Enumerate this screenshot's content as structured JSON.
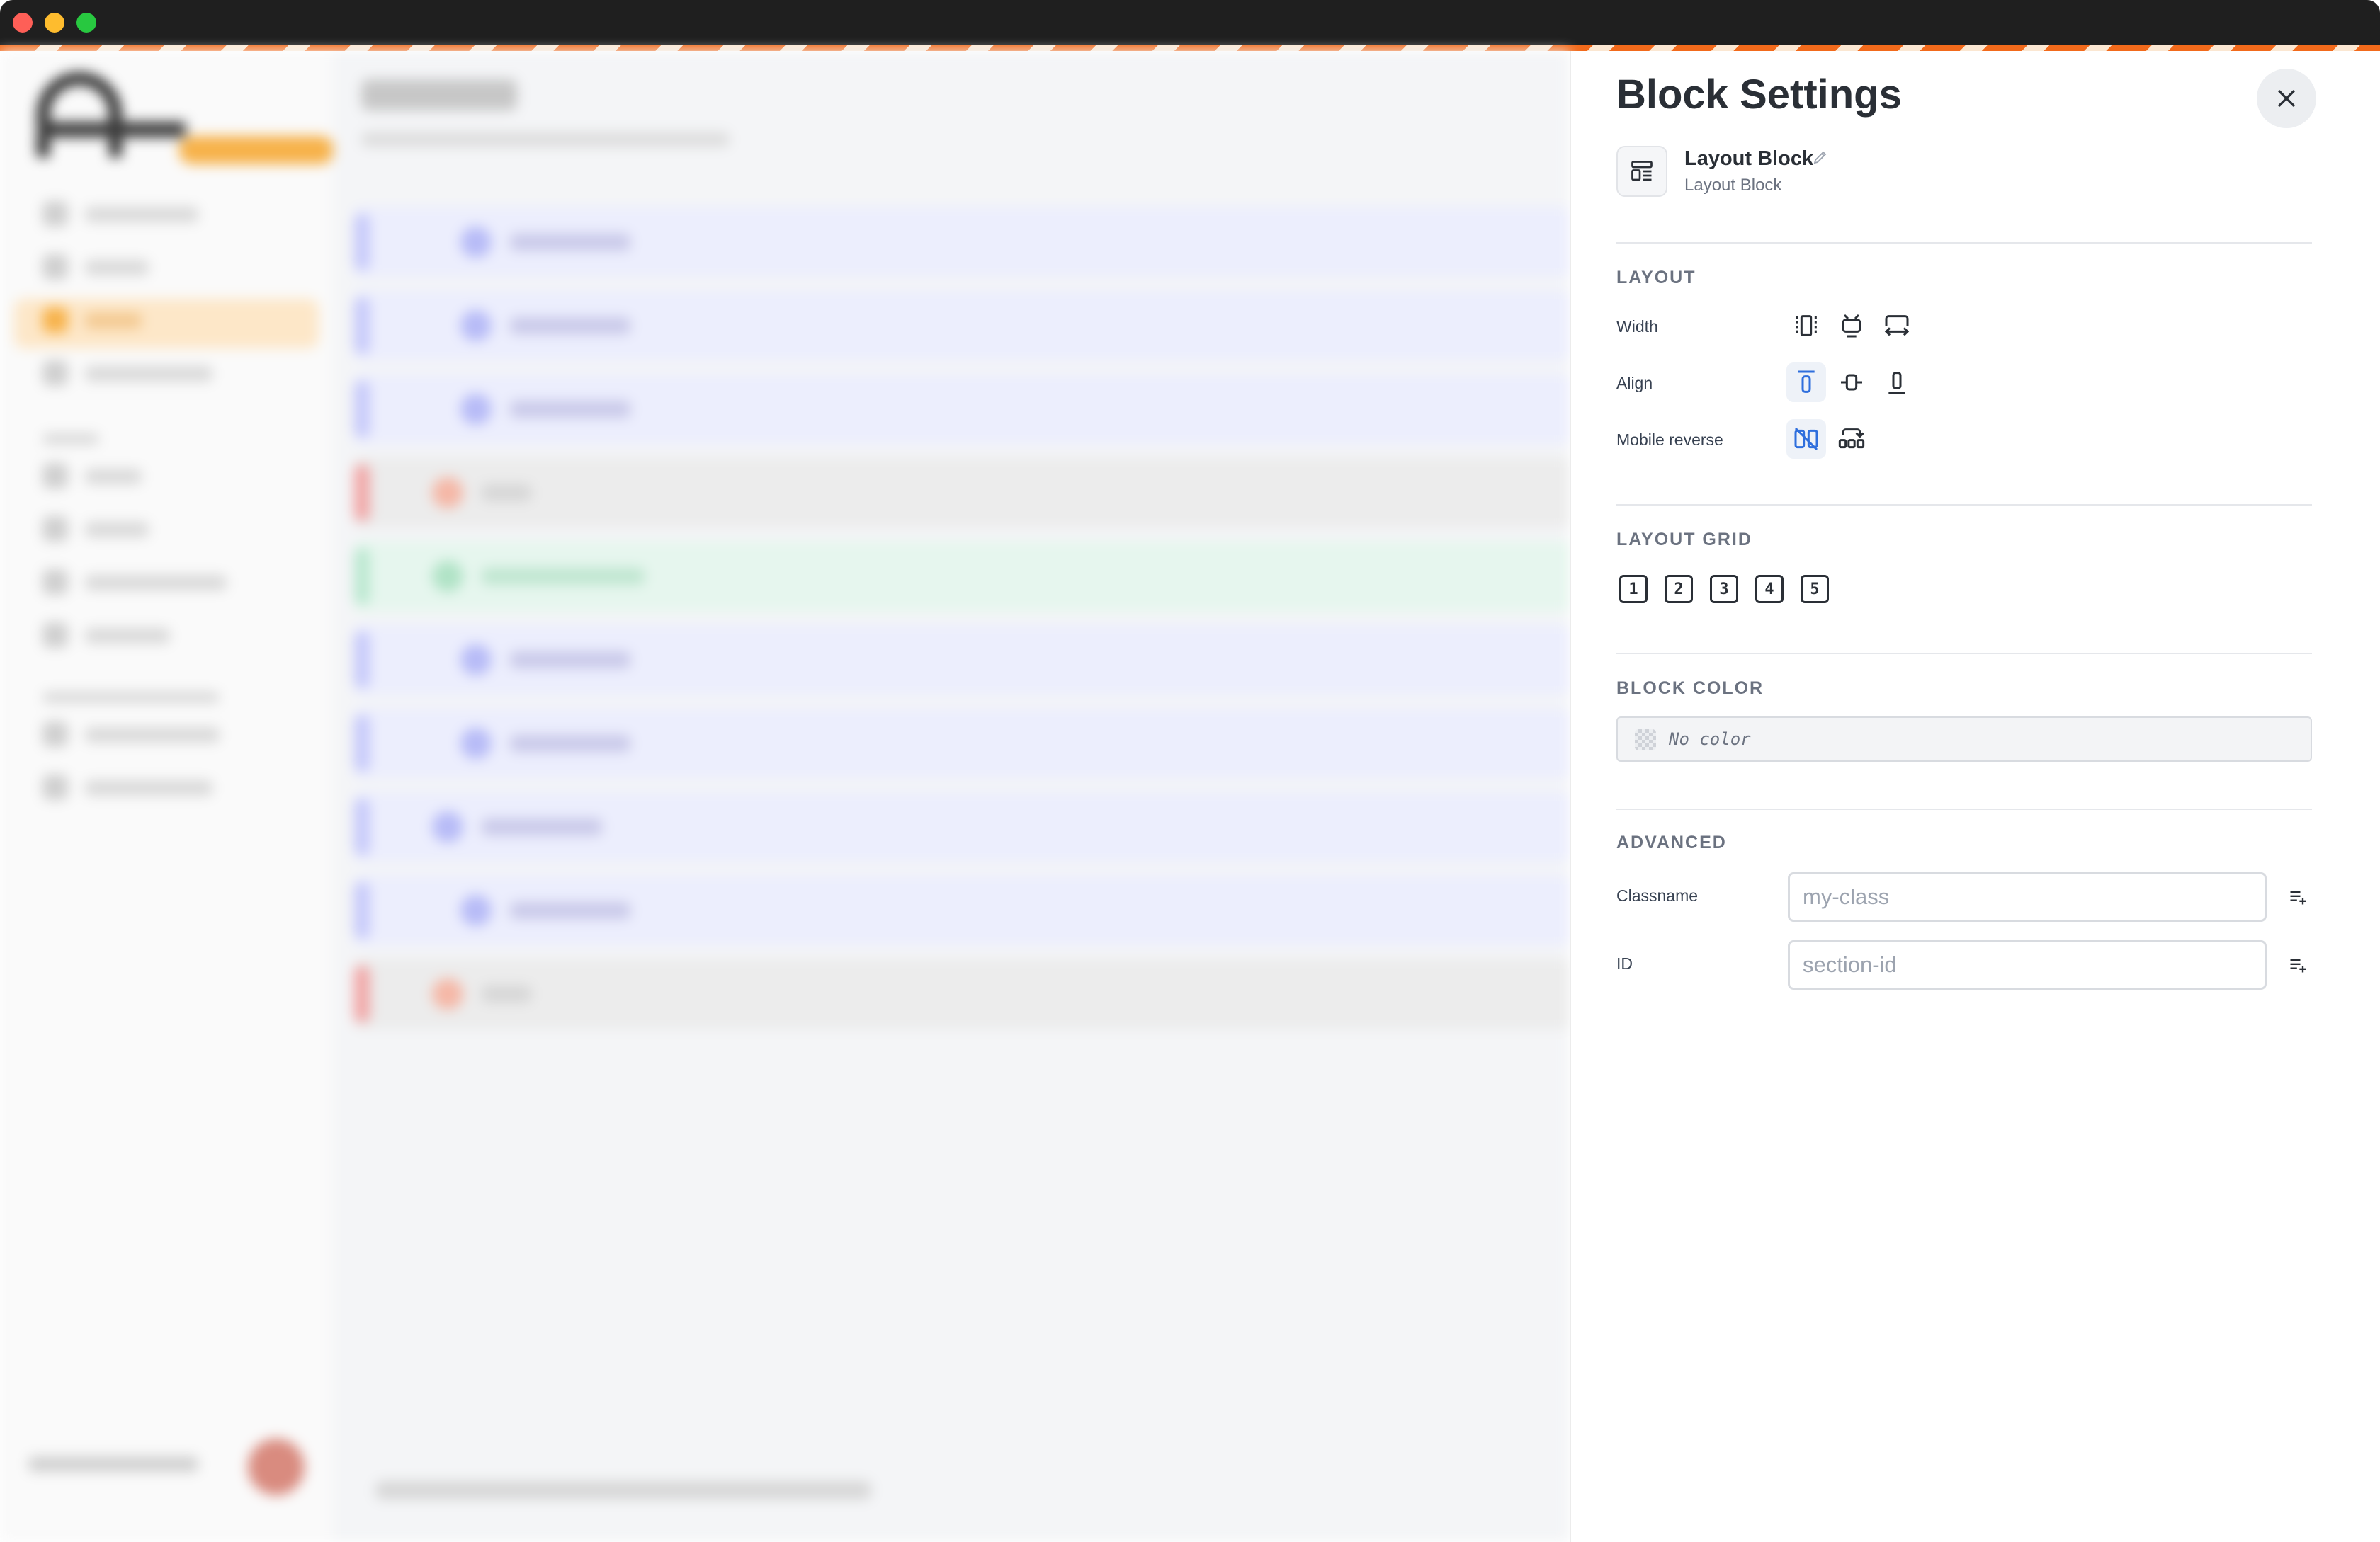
{
  "window": {
    "traffic_lights": [
      "close",
      "minimize",
      "zoom"
    ]
  },
  "panel": {
    "title": "Block Settings",
    "block": {
      "name": "Layout Block",
      "type": "Layout Block",
      "icon": "layout-block-icon"
    },
    "layout": {
      "label": "LAYOUT",
      "width": {
        "label": "Width",
        "options": [
          "width-narrow-icon",
          "width-medium-icon",
          "width-full-icon"
        ],
        "selected": null
      },
      "align": {
        "label": "Align",
        "options": [
          "align-top-icon",
          "align-center-icon",
          "align-bottom-icon"
        ],
        "selected": "align-top-icon"
      },
      "mobile_reverse": {
        "label": "Mobile reverse",
        "options": [
          "no-reverse-icon",
          "reverse-icon"
        ],
        "selected": "no-reverse-icon"
      }
    },
    "layout_grid": {
      "label": "LAYOUT GRID",
      "options": [
        "1",
        "2",
        "3",
        "4",
        "5"
      ]
    },
    "block_color": {
      "label": "BLOCK COLOR",
      "value": "No color"
    },
    "advanced": {
      "label": "ADVANCED",
      "classname": {
        "label": "Classname",
        "placeholder": "my-class",
        "value": ""
      },
      "id": {
        "label": "ID",
        "placeholder": "section-id",
        "value": ""
      }
    }
  },
  "colors": {
    "accent": "#2f6fdd",
    "text_primary": "#2a2f36",
    "text_muted": "#6b7280",
    "brand_orange": "#f26a1b"
  }
}
